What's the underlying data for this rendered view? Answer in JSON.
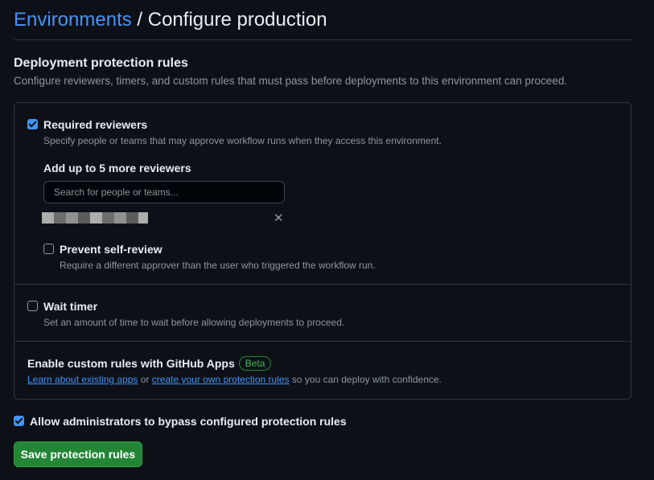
{
  "header": {
    "breadcrumb_link": "Environments",
    "separator": " / ",
    "current": "Configure production"
  },
  "section": {
    "title": "Deployment protection rules",
    "description": "Configure reviewers, timers, and custom rules that must pass before deployments to this environment can proceed."
  },
  "required_reviewers": {
    "checked": true,
    "label": "Required reviewers",
    "description": "Specify people or teams that may approve workflow runs when they access this environment.",
    "add_label": "Add up to 5 more reviewers",
    "search_placeholder": "Search for people or teams...",
    "remove_icon": "close-icon",
    "prevent_self_review": {
      "checked": false,
      "label": "Prevent self-review",
      "description": "Require a different approver than the user who triggered the workflow run."
    }
  },
  "wait_timer": {
    "checked": false,
    "label": "Wait timer",
    "description": "Set an amount of time to wait before allowing deployments to proceed."
  },
  "custom_rules": {
    "title": "Enable custom rules with GitHub Apps",
    "badge": "Beta",
    "link1": "Learn about existing apps",
    "middle": " or ",
    "link2": "create your own protection rules",
    "suffix": " so you can deploy with confidence."
  },
  "admin_bypass": {
    "checked": true,
    "label": "Allow administrators to bypass configured protection rules"
  },
  "save_button": "Save protection rules",
  "colors": {
    "background": "#0d1117",
    "link": "#4493f8",
    "primary_button": "#238636",
    "badge": "#3fb950",
    "border": "#30363d"
  }
}
